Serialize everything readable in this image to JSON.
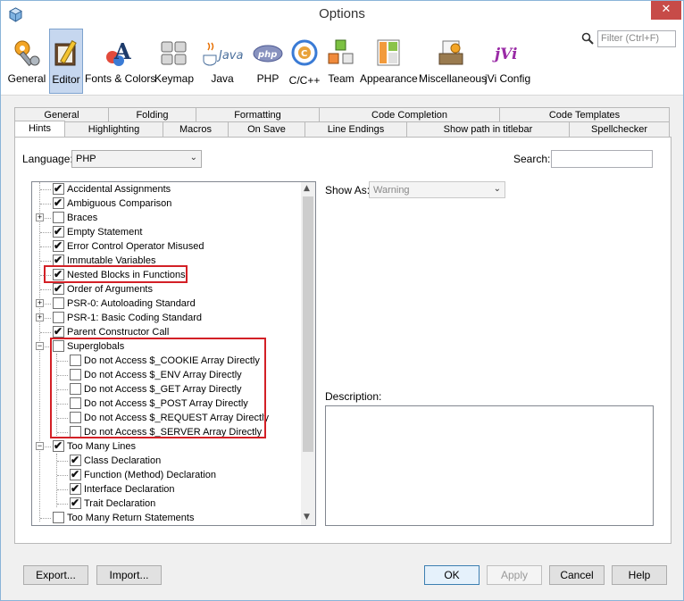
{
  "window": {
    "title": "Options",
    "close": "✕"
  },
  "toolbar": {
    "categories": [
      {
        "label": "General",
        "icon": "wrench-gear-icon"
      },
      {
        "label": "Editor",
        "icon": "editor-pencil-icon"
      },
      {
        "label": "Fonts & Colors",
        "icon": "fonts-colors-icon"
      },
      {
        "label": "Keymap",
        "icon": "keyboard-icon"
      },
      {
        "label": "Java",
        "icon": "java-cup-icon",
        "icon_text": "Java"
      },
      {
        "label": "PHP",
        "icon": "php-icon",
        "icon_text": "php"
      },
      {
        "label": "C/C++",
        "icon": "cpp-icon"
      },
      {
        "label": "Team",
        "icon": "team-cubes-icon"
      },
      {
        "label": "Appearance",
        "icon": "appearance-icon"
      },
      {
        "label": "Miscellaneous",
        "icon": "miscellaneous-icon"
      },
      {
        "label": "jVi Config",
        "icon": "jvi-icon",
        "icon_text": "jVi"
      }
    ],
    "selected": "Editor",
    "filter_placeholder": "Filter (Ctrl+F)"
  },
  "tabs_row1": [
    "General",
    "Folding",
    "Formatting",
    "Code Completion",
    "Code Templates"
  ],
  "tabs_row2": [
    "Hints",
    "Highlighting",
    "Macros",
    "On Save",
    "Line Endings",
    "Show path in titlebar",
    "Spellchecker"
  ],
  "active_tab": "Hints",
  "hints": {
    "language_label": "Language:",
    "language_value": "PHP",
    "search_label": "Search:",
    "search_value": "",
    "show_as_label": "Show As:",
    "show_as_value": "Warning",
    "description_label": "Description:",
    "tree": [
      {
        "label": "Accidental Assignments",
        "checked": true,
        "level": 0,
        "expander": ""
      },
      {
        "label": "Ambiguous Comparison",
        "checked": true,
        "level": 0,
        "expander": ""
      },
      {
        "label": "Braces",
        "checked": false,
        "level": 0,
        "expander": "+"
      },
      {
        "label": "Empty Statement",
        "checked": true,
        "level": 0,
        "expander": ""
      },
      {
        "label": "Error Control Operator Misused",
        "checked": true,
        "level": 0,
        "expander": ""
      },
      {
        "label": "Immutable Variables",
        "checked": true,
        "level": 0,
        "expander": ""
      },
      {
        "label": "Nested Blocks in Functions",
        "checked": true,
        "level": 0,
        "expander": ""
      },
      {
        "label": "Order of Arguments",
        "checked": true,
        "level": 0,
        "expander": ""
      },
      {
        "label": "PSR-0: Autoloading Standard",
        "checked": false,
        "level": 0,
        "expander": "+"
      },
      {
        "label": "PSR-1: Basic Coding Standard",
        "checked": false,
        "level": 0,
        "expander": "+"
      },
      {
        "label": "Parent Constructor Call",
        "checked": true,
        "level": 0,
        "expander": ""
      },
      {
        "label": "Superglobals",
        "checked": false,
        "level": 0,
        "expander": "−"
      },
      {
        "label": "Do not Access $_COOKIE Array Directly",
        "checked": false,
        "level": 1,
        "expander": ""
      },
      {
        "label": "Do not Access $_ENV Array Directly",
        "checked": false,
        "level": 1,
        "expander": ""
      },
      {
        "label": "Do not Access $_GET Array Directly",
        "checked": false,
        "level": 1,
        "expander": ""
      },
      {
        "label": "Do not Access $_POST Array Directly",
        "checked": false,
        "level": 1,
        "expander": ""
      },
      {
        "label": "Do not Access $_REQUEST Array Directly",
        "checked": false,
        "level": 1,
        "expander": ""
      },
      {
        "label": "Do not Access $_SERVER Array Directly",
        "checked": false,
        "level": 1,
        "expander": ""
      },
      {
        "label": "Too Many Lines",
        "checked": true,
        "level": 0,
        "expander": "−"
      },
      {
        "label": "Class Declaration",
        "checked": true,
        "level": 1,
        "expander": ""
      },
      {
        "label": "Function (Method) Declaration",
        "checked": true,
        "level": 1,
        "expander": ""
      },
      {
        "label": "Interface Declaration",
        "checked": true,
        "level": 1,
        "expander": ""
      },
      {
        "label": "Trait Declaration",
        "checked": true,
        "level": 1,
        "expander": ""
      },
      {
        "label": "Too Many Return Statements",
        "checked": false,
        "level": 0,
        "expander": ""
      }
    ]
  },
  "buttons": {
    "export": "Export...",
    "import": "Import...",
    "ok": "OK",
    "apply": "Apply",
    "cancel": "Cancel",
    "help": "Help"
  },
  "colors": {
    "highlight_box": "#d32026",
    "selected_category": "#c6d7ef"
  }
}
